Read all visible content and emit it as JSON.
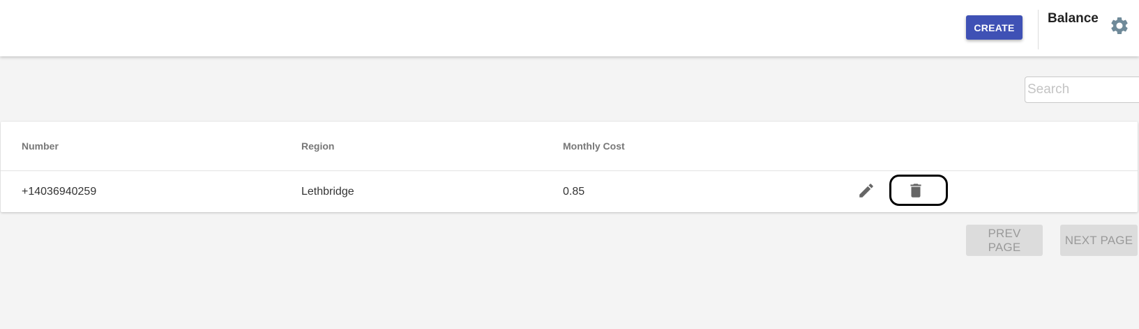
{
  "header": {
    "create_label": "CREATE",
    "balance_label": "Balance",
    "settings_icon": "gear-icon"
  },
  "search": {
    "placeholder": "Search",
    "value": ""
  },
  "table": {
    "columns": [
      "Number",
      "Region",
      "Monthly Cost"
    ],
    "rows": [
      {
        "number": "+14036940259",
        "region": "Lethbridge",
        "monthly_cost": "0.85",
        "actions": [
          "edit-icon",
          "delete-icon"
        ]
      }
    ]
  },
  "pagination": {
    "prev_label": "PREV PAGE",
    "next_label": "NEXT PAGE"
  },
  "colors": {
    "primary": "#3f51b5",
    "background": "#f4f4f4",
    "icon": "#666666",
    "disabled_button": "#dcdcdc",
    "annotation": "#000000"
  }
}
